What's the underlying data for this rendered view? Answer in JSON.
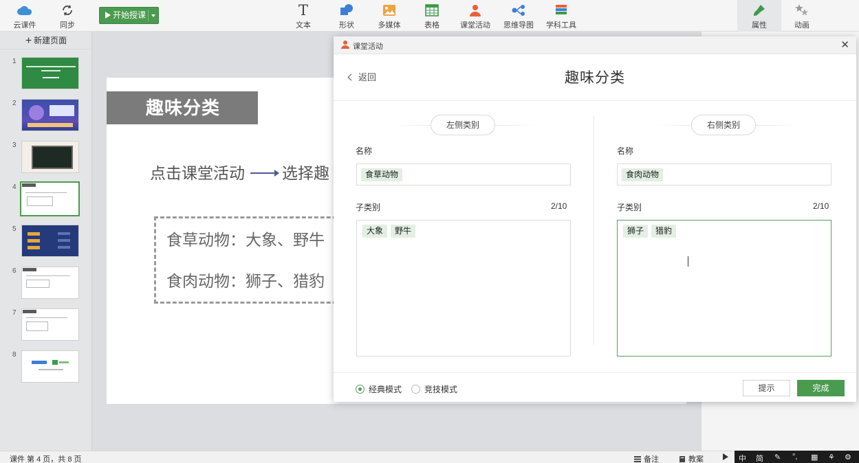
{
  "toolbar": {
    "cloud": "云课件",
    "sync": "同步",
    "start": "开始授课",
    "text": "文本",
    "shape": "形状",
    "media": "多媒体",
    "table": "表格",
    "activity": "课堂活动",
    "mindmap": "思维导图",
    "tools": "学科工具",
    "props": "属性",
    "anim": "动画"
  },
  "sidebar": {
    "new_page": "新建页面",
    "thumbs": [
      "1",
      "2",
      "3",
      "4",
      "5",
      "6",
      "7",
      "8"
    ],
    "selected": 4
  },
  "slide": {
    "title": "趣味分类",
    "line1_a": "点击课堂活动",
    "line1_b": "选择趣",
    "row1": "食草动物：大象、野牛",
    "row2": "食肉动物：狮子、猎豹"
  },
  "dialog": {
    "window_title": "课堂活动",
    "back": "返回",
    "heading": "趣味分类",
    "name_label": "名称",
    "sub_label": "子类别",
    "left": {
      "category": "左侧类别",
      "name": "食草动物",
      "count": "2/10",
      "items": [
        "大象",
        "野牛"
      ]
    },
    "right": {
      "category": "右侧类别",
      "name": "食肉动物",
      "count": "2/10",
      "items": [
        "狮子",
        "猎豹"
      ]
    },
    "mode_classic": "经典模式",
    "mode_compete": "竞技模式",
    "hint": "提示",
    "done": "完成"
  },
  "status": {
    "page_info": "课件 第 4 页，共 8 页",
    "notes": "备注",
    "plan": "教案"
  },
  "taskbar": {
    "ime": "中",
    "simp": "简"
  },
  "colors": {
    "accent": "#4a9a4f",
    "tag_bg": "#e3efe3"
  }
}
